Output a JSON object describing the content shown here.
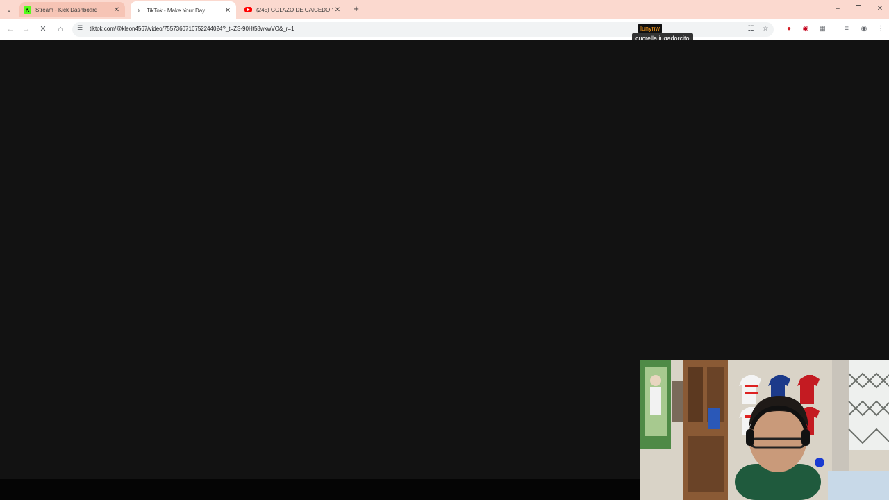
{
  "tabs": [
    {
      "title": "Stream - Kick Dashboard",
      "favicon": "kick-icon",
      "state": "hover"
    },
    {
      "title": "TikTok - Make Your Day",
      "favicon": "tiktok-icon",
      "state": "active"
    },
    {
      "title": "(245) GOLAZO DE CAICEDO Y",
      "favicon": "youtube-icon",
      "state": "inactive"
    }
  ],
  "new_tab": "+",
  "address": {
    "url": "tiktok.com/@kleon4567/video/7557360716752244024?_t=ZS-90Ht58wkwVO&_r=1"
  },
  "overlay_chat": {
    "username": "lunynw",
    "message": "cucrella jugadorcito"
  },
  "colors": {
    "tab_strip": "#fbd9cf",
    "page_background": "#121212",
    "chat_username": "#ff9e1a",
    "kick_green": "#53fc18"
  }
}
